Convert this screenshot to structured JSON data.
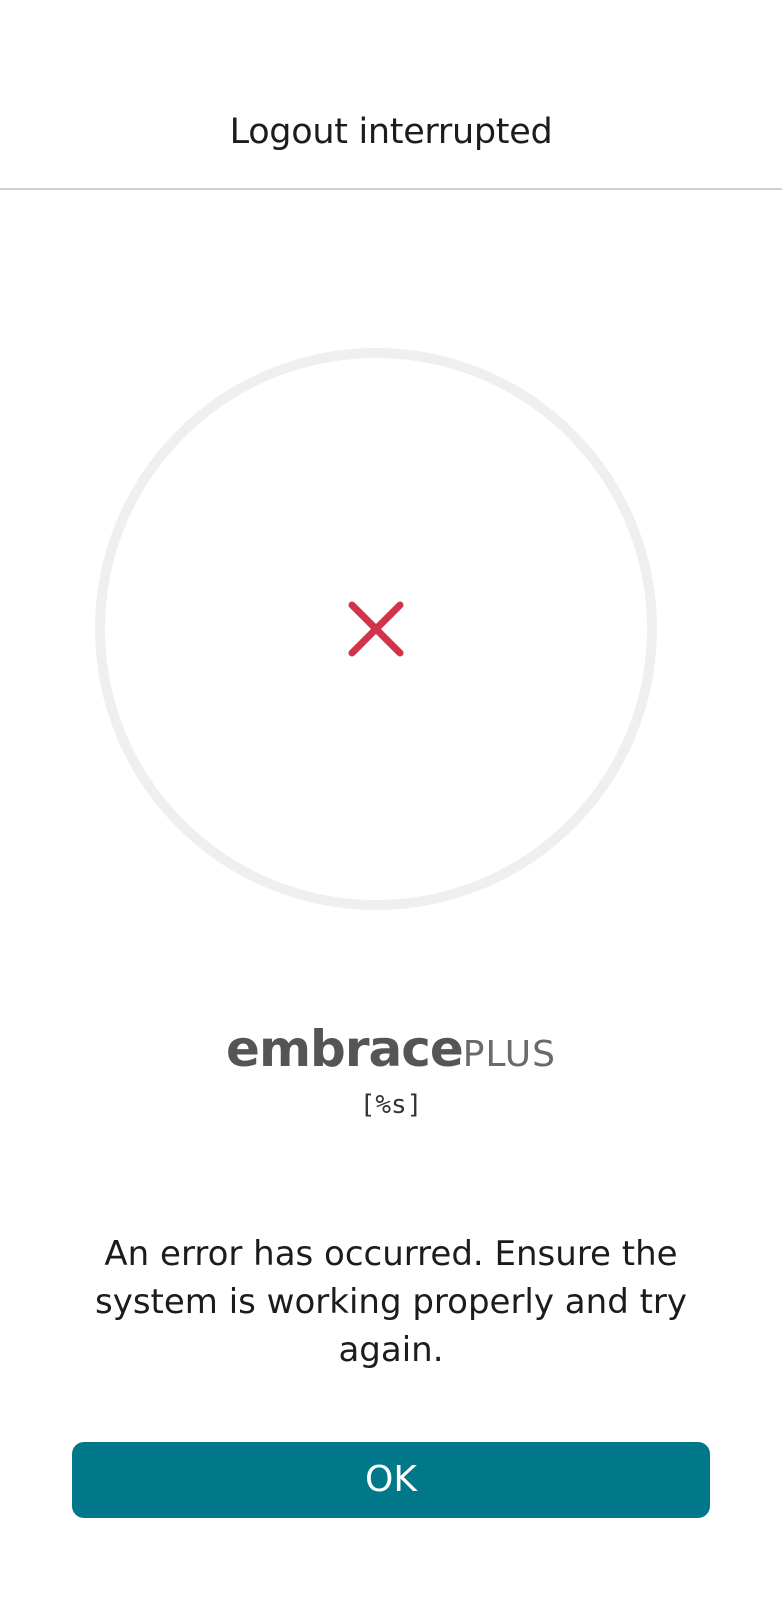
{
  "header": {
    "title": "Logout interrupted"
  },
  "status": {
    "icon": "close-icon",
    "icon_color": "#D0344A",
    "ring_color": "#EFEFEF"
  },
  "logo": {
    "main": "embrace",
    "sub": "PLUS"
  },
  "version": "[%s]",
  "message": "An error has occurred. Ensure the system is working properly and try again.",
  "actions": {
    "ok_label": "OK",
    "ok_color": "#00788A"
  }
}
